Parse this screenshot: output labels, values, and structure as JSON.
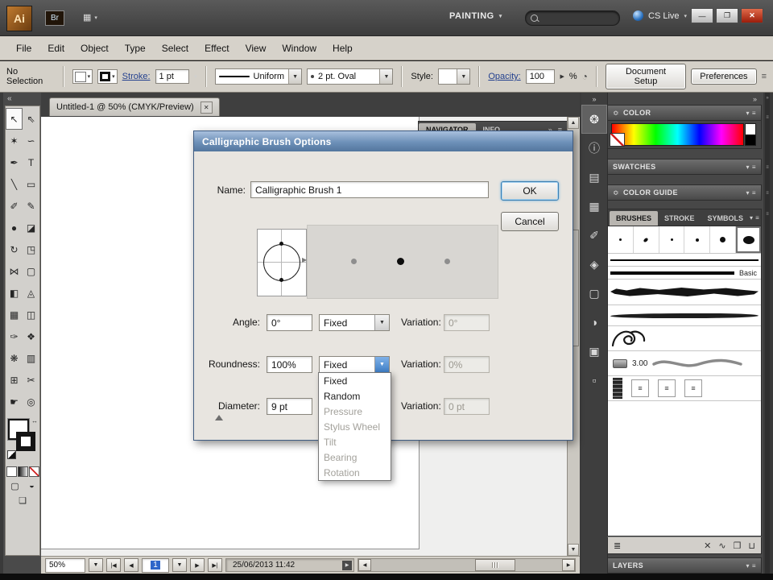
{
  "app_bar": {
    "logo": "Ai",
    "bridge": "Br",
    "workspace": "PAINTING",
    "cs_live": "CS Live"
  },
  "menus": [
    "File",
    "Edit",
    "Object",
    "Type",
    "Select",
    "Effect",
    "View",
    "Window",
    "Help"
  ],
  "control_bar": {
    "no_selection": "No Selection",
    "stroke_label": "Stroke:",
    "stroke_value": "1 pt",
    "brush_name": "Uniform",
    "variable_width": "2 pt. Oval",
    "style_label": "Style:",
    "opacity_label": "Opacity:",
    "opacity_value": "100",
    "percent": "%",
    "document_setup": "Document Setup",
    "preferences": "Preferences"
  },
  "document_tab": {
    "title": "Untitled-1 @ 50% (CMYK/Preview)"
  },
  "dialog": {
    "title": "Calligraphic Brush Options",
    "name_label": "Name:",
    "name_value": "Calligraphic Brush 1",
    "ok": "OK",
    "cancel": "Cancel",
    "angle_label": "Angle:",
    "angle_value": "0°",
    "angle_control": "Fixed",
    "roundness_label": "Roundness:",
    "roundness_value": "100%",
    "roundness_control": "Fixed",
    "diameter_label": "Diameter:",
    "diameter_value": "9 pt",
    "variation_label": "Variation:",
    "angle_variation": "0°",
    "roundness_variation": "0%",
    "diameter_variation": "0 pt",
    "options": [
      {
        "label": "Fixed",
        "disabled": false
      },
      {
        "label": "Random",
        "disabled": false
      },
      {
        "label": "Pressure",
        "disabled": true
      },
      {
        "label": "Stylus Wheel",
        "disabled": true
      },
      {
        "label": "Tilt",
        "disabled": true
      },
      {
        "label": "Bearing",
        "disabled": true
      },
      {
        "label": "Rotation",
        "disabled": true
      }
    ]
  },
  "panels": {
    "navigator": "NAVIGATOR",
    "info": "INFO",
    "color": "COLOR",
    "swatches": "SWATCHES",
    "color_guide": "COLOR GUIDE",
    "brushes": "BRUSHES",
    "stroke": "STROKE",
    "symbols": "SYMBOLS",
    "basic": "Basic",
    "wave": "3.00",
    "layers": "LAYERS"
  },
  "status_bar": {
    "zoom": "50%",
    "artboard": "1",
    "datetime": "25/06/2013 11:42"
  },
  "icons": {
    "window_minimize": "—",
    "window_maximize": "❐",
    "window_close": "✕",
    "dropdown": "▼",
    "caret_down": "▾",
    "collapse_left": "«",
    "expand_right": "»",
    "panel_menu": "≡",
    "collapse_caret": "≎",
    "tab_close": "✕",
    "nav_first": "|◀",
    "nav_prev": "◀",
    "nav_next": "▶",
    "nav_last": "▶|",
    "play": "▶",
    "scroll_up": "▲",
    "scroll_down": "▼",
    "scroll_left": "◀",
    "scroll_right": "▶",
    "preview_arrow": "▶",
    "swap": "↔",
    "opacity": "◔",
    "tile_lines": "≡"
  },
  "tools": [
    {
      "name": "selection-tool-icon",
      "glyph": "↖",
      "active": true
    },
    {
      "name": "direct-selection-tool-icon",
      "glyph": "⇖",
      "active": false
    },
    {
      "name": "magic-wand-tool-icon",
      "glyph": "✶",
      "active": false
    },
    {
      "name": "lasso-tool-icon",
      "glyph": "∽",
      "active": false
    },
    {
      "name": "pen-tool-icon",
      "glyph": "✒",
      "active": false
    },
    {
      "name": "type-tool-icon",
      "glyph": "T",
      "active": false
    },
    {
      "name": "line-segment-tool-icon",
      "glyph": "╲",
      "active": false
    },
    {
      "name": "rectangle-tool-icon",
      "glyph": "▭",
      "active": false
    },
    {
      "name": "paintbrush-tool-icon",
      "glyph": "✐",
      "active": false
    },
    {
      "name": "pencil-tool-icon",
      "glyph": "✎",
      "active": false
    },
    {
      "name": "blob-brush-tool-icon",
      "glyph": "●",
      "active": false
    },
    {
      "name": "eraser-tool-icon",
      "glyph": "◪",
      "active": false
    },
    {
      "name": "rotate-tool-icon",
      "glyph": "↻",
      "active": false
    },
    {
      "name": "scale-tool-icon",
      "glyph": "◳",
      "active": false
    },
    {
      "name": "width-tool-icon",
      "glyph": "⋈",
      "active": false
    },
    {
      "name": "free-transform-tool-icon",
      "glyph": "▢",
      "active": false
    },
    {
      "name": "shape-builder-tool-icon",
      "glyph": "◧",
      "active": false
    },
    {
      "name": "perspective-grid-tool-icon",
      "glyph": "◬",
      "active": false
    },
    {
      "name": "mesh-tool-icon",
      "glyph": "▦",
      "active": false
    },
    {
      "name": "gradient-tool-icon",
      "glyph": "◫",
      "active": false
    },
    {
      "name": "eyedropper-tool-icon",
      "glyph": "✑",
      "active": false
    },
    {
      "name": "blend-tool-icon",
      "glyph": "❖",
      "active": false
    },
    {
      "name": "symbol-sprayer-tool-icon",
      "glyph": "❋",
      "active": false
    },
    {
      "name": "column-graph-tool-icon",
      "glyph": "▥",
      "active": false
    },
    {
      "name": "artboard-tool-icon",
      "glyph": "⊞",
      "active": false
    },
    {
      "name": "slice-tool-icon",
      "glyph": "✂",
      "active": false
    },
    {
      "name": "hand-tool-icon",
      "glyph": "☛",
      "active": false
    },
    {
      "name": "zoom-tool-icon",
      "glyph": "◎",
      "active": false
    }
  ],
  "toolbar_extras": {
    "draw_normal": "▢",
    "draw_behind": "◒",
    "screen_mode": "❏"
  },
  "dock_icons": [
    {
      "name": "color-panel-icon",
      "glyph": "❂",
      "active": true
    },
    {
      "name": "info-panel-icon",
      "glyph": "ⓘ",
      "active": false
    },
    {
      "name": "color-guide-panel-icon",
      "glyph": "▤",
      "active": false
    },
    {
      "name": "swatches-panel-icon",
      "glyph": "▦",
      "active": false
    },
    {
      "name": "brushes-panel-icon",
      "glyph": "✐",
      "active": false
    },
    {
      "name": "symbols-panel-icon",
      "glyph": "◈",
      "active": false
    },
    {
      "name": "artboards-panel-icon",
      "glyph": "▢",
      "active": false
    },
    {
      "name": "appearance-panel-icon",
      "glyph": "◑",
      "active": false
    },
    {
      "name": "graphic-styles-panel-icon",
      "glyph": "▣",
      "active": false
    },
    {
      "name": "links-panel-icon",
      "glyph": "▫",
      "active": false
    }
  ],
  "footer_icons": [
    {
      "name": "brush-libraries-menu-icon",
      "glyph": "≣",
      "group": "left"
    },
    {
      "name": "remove-brush-stroke-icon",
      "glyph": "✕",
      "group": "right"
    },
    {
      "name": "options-of-selected-object-icon",
      "glyph": "∿",
      "group": "right"
    },
    {
      "name": "new-brush-icon",
      "glyph": "❐",
      "group": "right"
    },
    {
      "name": "delete-brush-icon",
      "glyph": "⊔",
      "group": "right"
    }
  ]
}
